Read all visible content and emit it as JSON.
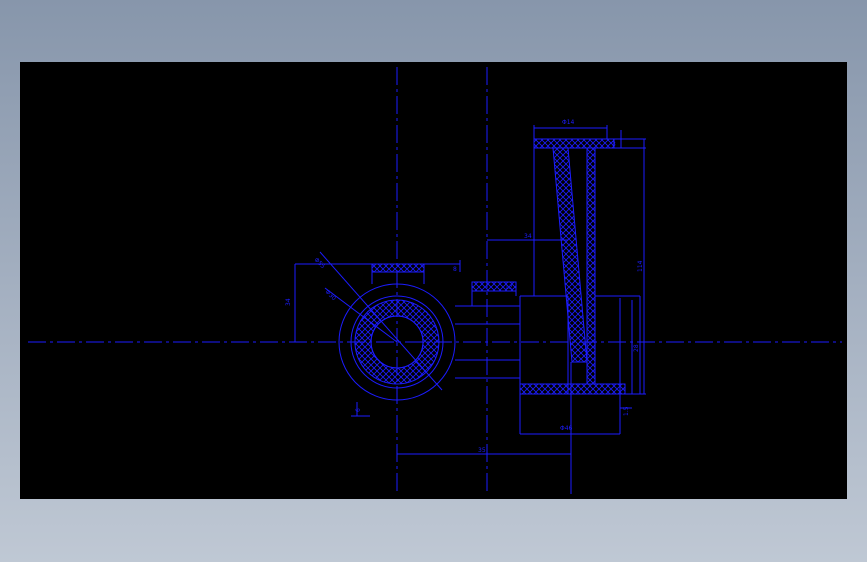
{
  "drawing": {
    "colors": {
      "background": "#000000",
      "line": "#1c1cff",
      "frame": "#8796ab"
    },
    "dimensions": {
      "d_top_width": "Φ14",
      "d_top_t": "3",
      "d_small": "8",
      "d_flange": "12",
      "d_height_34": "34",
      "d_outer_dia": "Φ55",
      "d_inner_dia": "Φ30",
      "d_height_34_left": "34",
      "d_thick": "6",
      "d_bottom_width": "Φ46",
      "d_bottom_t": "1.5",
      "d_right_height": "28",
      "d_baseline_35": "35",
      "d_total_height": "114"
    }
  }
}
